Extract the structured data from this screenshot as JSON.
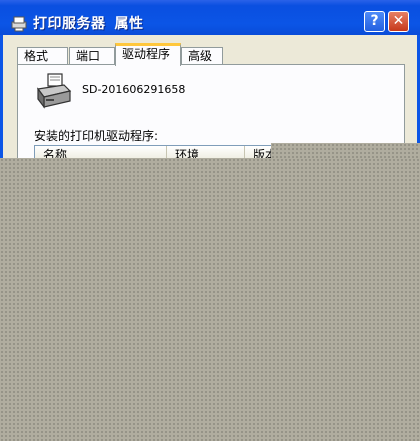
{
  "window": {
    "title": "打印服务器",
    "title_suffix": "属性",
    "help_label": "?",
    "close_label": "✕",
    "icon": "printer-icon"
  },
  "tabs": [
    {
      "label": "格式"
    },
    {
      "label": "端口"
    },
    {
      "label": "驱动程序",
      "active": true
    },
    {
      "label": "高级"
    }
  ],
  "server": {
    "name": "SD-201606291658"
  },
  "drivers": {
    "label": "安装的打印机驱动程序:",
    "columns": [
      "名称",
      "环境",
      "版本"
    ]
  },
  "colors": {
    "titlebar": "#0b55e6",
    "window_bg": "#ece9d8",
    "active_tab_accent": "#ffc73c",
    "mask": "#b0ad9f"
  }
}
